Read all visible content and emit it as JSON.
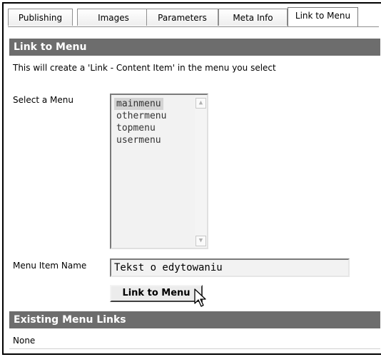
{
  "tabs": [
    {
      "label": "Publishing"
    },
    {
      "label": "Images"
    },
    {
      "label": "Parameters"
    },
    {
      "label": "Meta Info"
    },
    {
      "label": "Link to Menu"
    }
  ],
  "link_section": {
    "title": "Link to Menu",
    "description": "This will create a 'Link - Content Item' in the menu you select",
    "select_label": "Select a Menu",
    "menus": [
      "mainmenu",
      "othermenu",
      "topmenu",
      "usermenu"
    ],
    "selected_menu": "mainmenu",
    "name_label": "Menu Item Name",
    "name_value": "Tekst o edytowaniu",
    "button_label": "Link to Menu"
  },
  "existing_section": {
    "title": "Existing Menu Links",
    "value": "None"
  },
  "icons": {
    "scroll_up": "chevron-up-icon",
    "scroll_down": "chevron-down-icon",
    "cursor": "mouse-pointer-icon"
  },
  "colors": {
    "header_bg": "#6d6d6d",
    "header_text": "#ffffff",
    "selection_bg": "#d4d4d4",
    "field_bg": "#f2f2f2"
  }
}
